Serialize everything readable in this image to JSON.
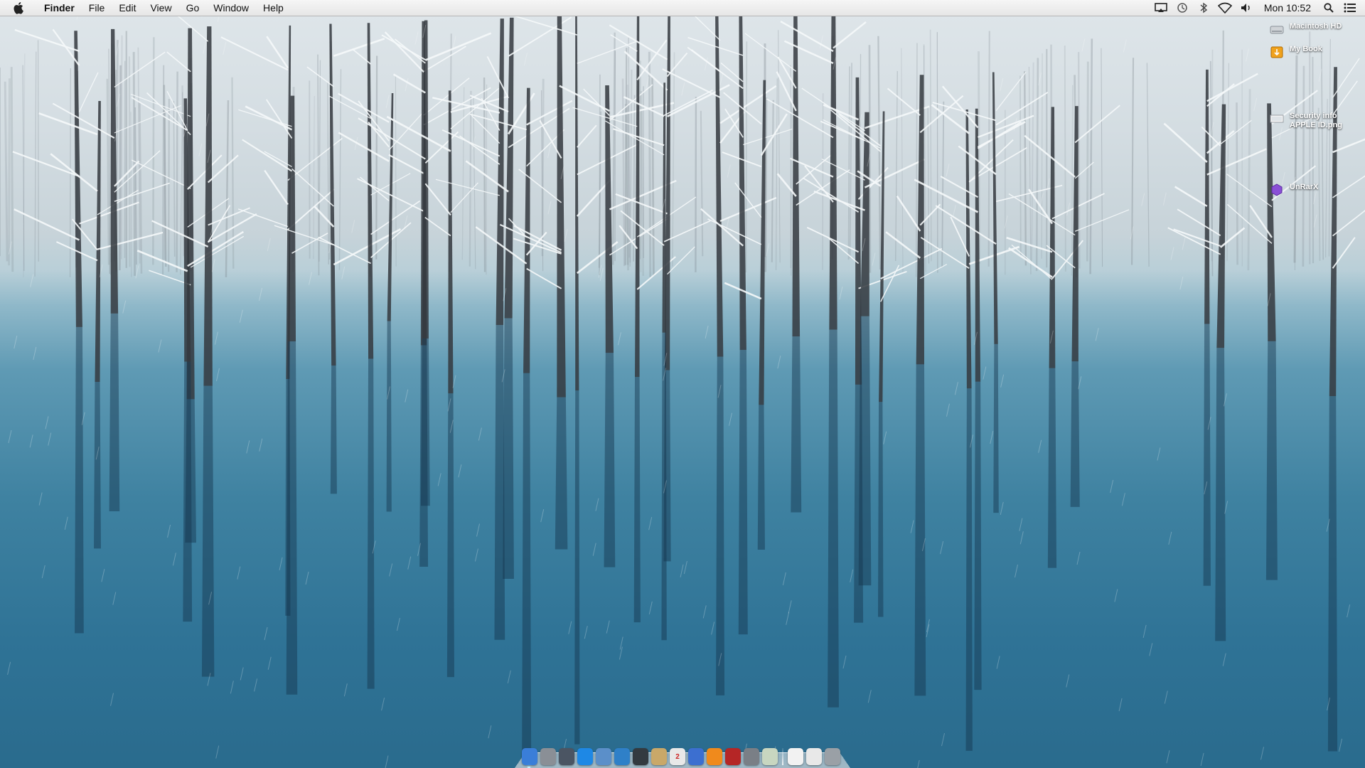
{
  "menubar": {
    "app_name": "Finder",
    "menus": [
      "File",
      "Edit",
      "View",
      "Go",
      "Window",
      "Help"
    ],
    "clock": "Mon 10:52",
    "status_icons": [
      "airplay-icon",
      "time-machine-icon",
      "bluetooth-icon",
      "wifi-icon",
      "volume-icon",
      "spotlight-icon",
      "notification-center-icon"
    ]
  },
  "desktop": {
    "icons": [
      {
        "label": "Macintosh HD",
        "icon": "hard-drive-icon"
      },
      {
        "label": "My Book",
        "icon": "external-drive-icon"
      },
      {
        "label": "Security info APPLE ID.png",
        "icon": "image-file-icon"
      },
      {
        "label": "UnRarX",
        "icon": "app-icon"
      }
    ]
  },
  "dock": {
    "apps": [
      {
        "name": "Finder",
        "icon": "finder-icon",
        "color": "#3a7ed8"
      },
      {
        "name": "Launchpad",
        "icon": "launchpad-icon",
        "color": "#8a8f96"
      },
      {
        "name": "Mission Control",
        "icon": "mission-control-icon",
        "color": "#4b5563"
      },
      {
        "name": "App Store",
        "icon": "app-store-icon",
        "color": "#1e88e5"
      },
      {
        "name": "Preview",
        "icon": "preview-icon",
        "color": "#5b8fc9"
      },
      {
        "name": "Safari",
        "icon": "safari-icon",
        "color": "#2f80c8"
      },
      {
        "name": "FaceTime",
        "icon": "camera-icon",
        "color": "#333a40"
      },
      {
        "name": "Notes",
        "icon": "notes-icon",
        "color": "#c9a869"
      },
      {
        "name": "Calendar",
        "icon": "calendar-icon",
        "color": "#e8e8e8",
        "text": "2"
      },
      {
        "name": "iTunes",
        "icon": "itunes-icon",
        "color": "#3c6fd0"
      },
      {
        "name": "iBooks",
        "icon": "ibooks-icon",
        "color": "#f08a1c"
      },
      {
        "name": "Photo Booth",
        "icon": "photo-booth-icon",
        "color": "#b52626"
      },
      {
        "name": "System Preferences",
        "icon": "system-preferences-icon",
        "color": "#7a7f86"
      },
      {
        "name": "Preview Docs",
        "icon": "documents-icon",
        "color": "#c8d6c0"
      }
    ],
    "stacks": [
      {
        "name": "Document",
        "icon": "document-icon",
        "color": "#f2f2f2"
      },
      {
        "name": "Document 2",
        "icon": "document-icon",
        "color": "#e8e8e8"
      },
      {
        "name": "Trash",
        "icon": "trash-icon",
        "color": "#9aa0a6"
      }
    ]
  }
}
